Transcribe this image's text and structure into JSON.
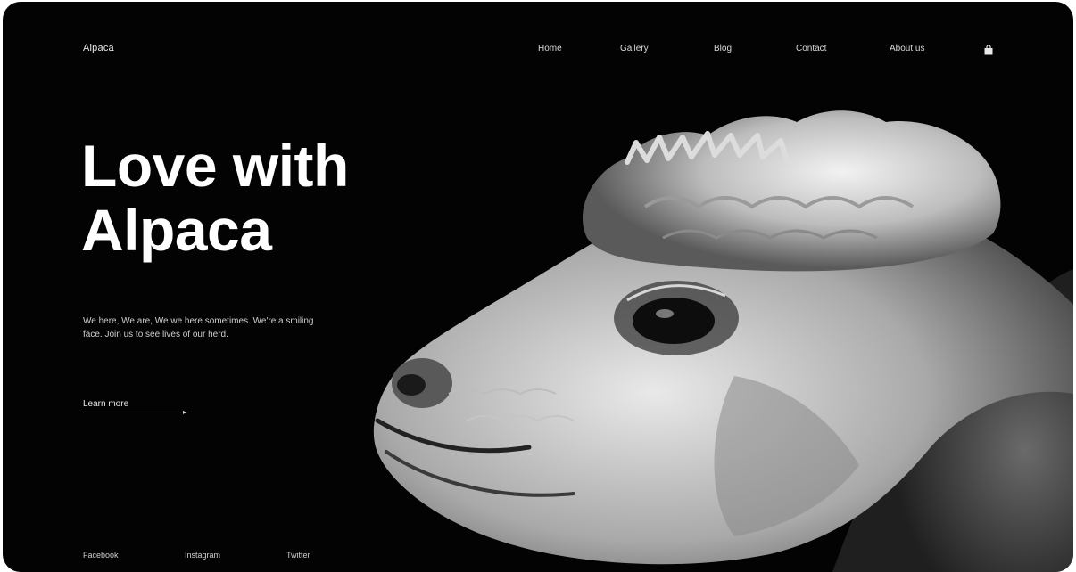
{
  "nav": {
    "brand": "Alpaca",
    "links": [
      "Home",
      "Gallery",
      "Blog",
      "Contact",
      "About us"
    ],
    "cart_icon": "shopping-bag-icon"
  },
  "hero": {
    "title_line1": "Love with",
    "title_line2": "Alpaca",
    "description": "We here, We are, We we here sometimes. We're a smiling face. Join us to see lives of our herd.",
    "cta_label": "Learn more",
    "cta_icon": "arrow-right-icon",
    "image_icon": "alpaca-portrait-photo"
  },
  "bottom_links": [
    "Facebook",
    "Instagram",
    "Twitter"
  ],
  "colors": {
    "background": "#030303",
    "text": "#ffffff",
    "muted_text": "#cfcfcf"
  }
}
